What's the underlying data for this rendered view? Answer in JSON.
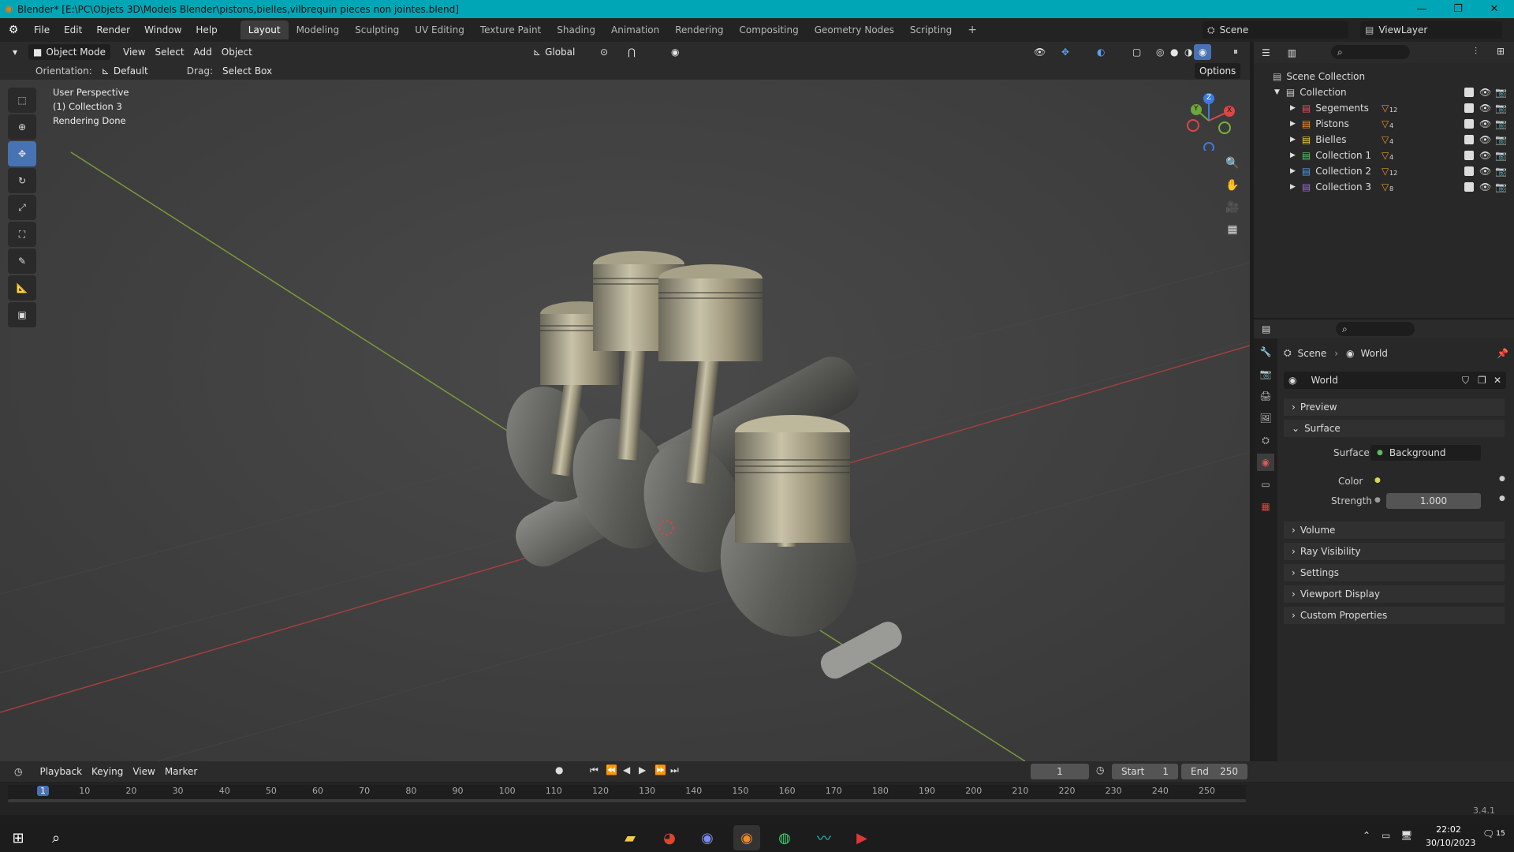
{
  "titlebar": {
    "title": "Blender* [E:\\PC\\Objets 3D\\Models Blender\\pistons,bielles,vilbrequin pieces non jointes.blend]"
  },
  "menu": [
    "File",
    "Edit",
    "Render",
    "Window",
    "Help"
  ],
  "workspaces": [
    "Layout",
    "Modeling",
    "Sculpting",
    "UV Editing",
    "Texture Paint",
    "Shading",
    "Animation",
    "Rendering",
    "Compositing",
    "Geometry Nodes",
    "Scripting"
  ],
  "scene": {
    "name": "Scene",
    "view_layer": "ViewLayer"
  },
  "viewport_header": {
    "mode": "Object Mode",
    "view": "View",
    "select": "Select",
    "add": "Add",
    "object": "Object",
    "transform": "Global"
  },
  "tool_settings": {
    "orientation_label": "Orientation:",
    "orientation_value": "Default",
    "drag_label": "Drag:",
    "drag_value": "Select Box",
    "options": "Options"
  },
  "viewport_info": {
    "line1": "User Perspective",
    "line2": "(1) Collection 3",
    "line3": "Rendering Done"
  },
  "gizmo": {
    "z": "Z",
    "y": "Y",
    "x": "X"
  },
  "outliner": {
    "root": "Scene Collection",
    "collection": "Collection",
    "items": [
      {
        "name": "Segements",
        "count": "12",
        "color": "#e0535f"
      },
      {
        "name": "Pistons",
        "count": "4",
        "color": "#f08f2b"
      },
      {
        "name": "Bielles",
        "count": "4",
        "color": "#e8d03a"
      },
      {
        "name": "Collection 1",
        "count": "4",
        "color": "#59c06a"
      },
      {
        "name": "Collection 2",
        "count": "12",
        "color": "#4f9be0"
      },
      {
        "name": "Collection 3",
        "count": "8",
        "color": "#9b6ad9"
      }
    ]
  },
  "properties": {
    "breadcrumb_scene": "Scene",
    "breadcrumb_world": "World",
    "world_name": "World",
    "panels": {
      "preview": "Preview",
      "surface": "Surface",
      "volume": "Volume",
      "ray_visibility": "Ray Visibility",
      "settings": "Settings",
      "viewport_display": "Viewport Display",
      "custom_properties": "Custom Properties"
    },
    "surface_label": "Surface",
    "surface_value": "Background",
    "color_label": "Color",
    "strength_label": "Strength",
    "strength_value": "1.000"
  },
  "timeline": {
    "playback": "Playback",
    "keying": "Keying",
    "view": "View",
    "marker": "Marker",
    "current_frame": "1",
    "start_label": "Start",
    "start": "1",
    "end_label": "End",
    "end": "250",
    "ticks": [
      "1",
      "10",
      "20",
      "30",
      "40",
      "50",
      "60",
      "70",
      "80",
      "90",
      "100",
      "110",
      "120",
      "130",
      "140",
      "150",
      "160",
      "170",
      "180",
      "190",
      "200",
      "210",
      "220",
      "230",
      "240",
      "250"
    ]
  },
  "version": "3.4.1",
  "taskbar": {
    "time": "22:02",
    "date": "30/10/2023",
    "notifications": "15"
  }
}
